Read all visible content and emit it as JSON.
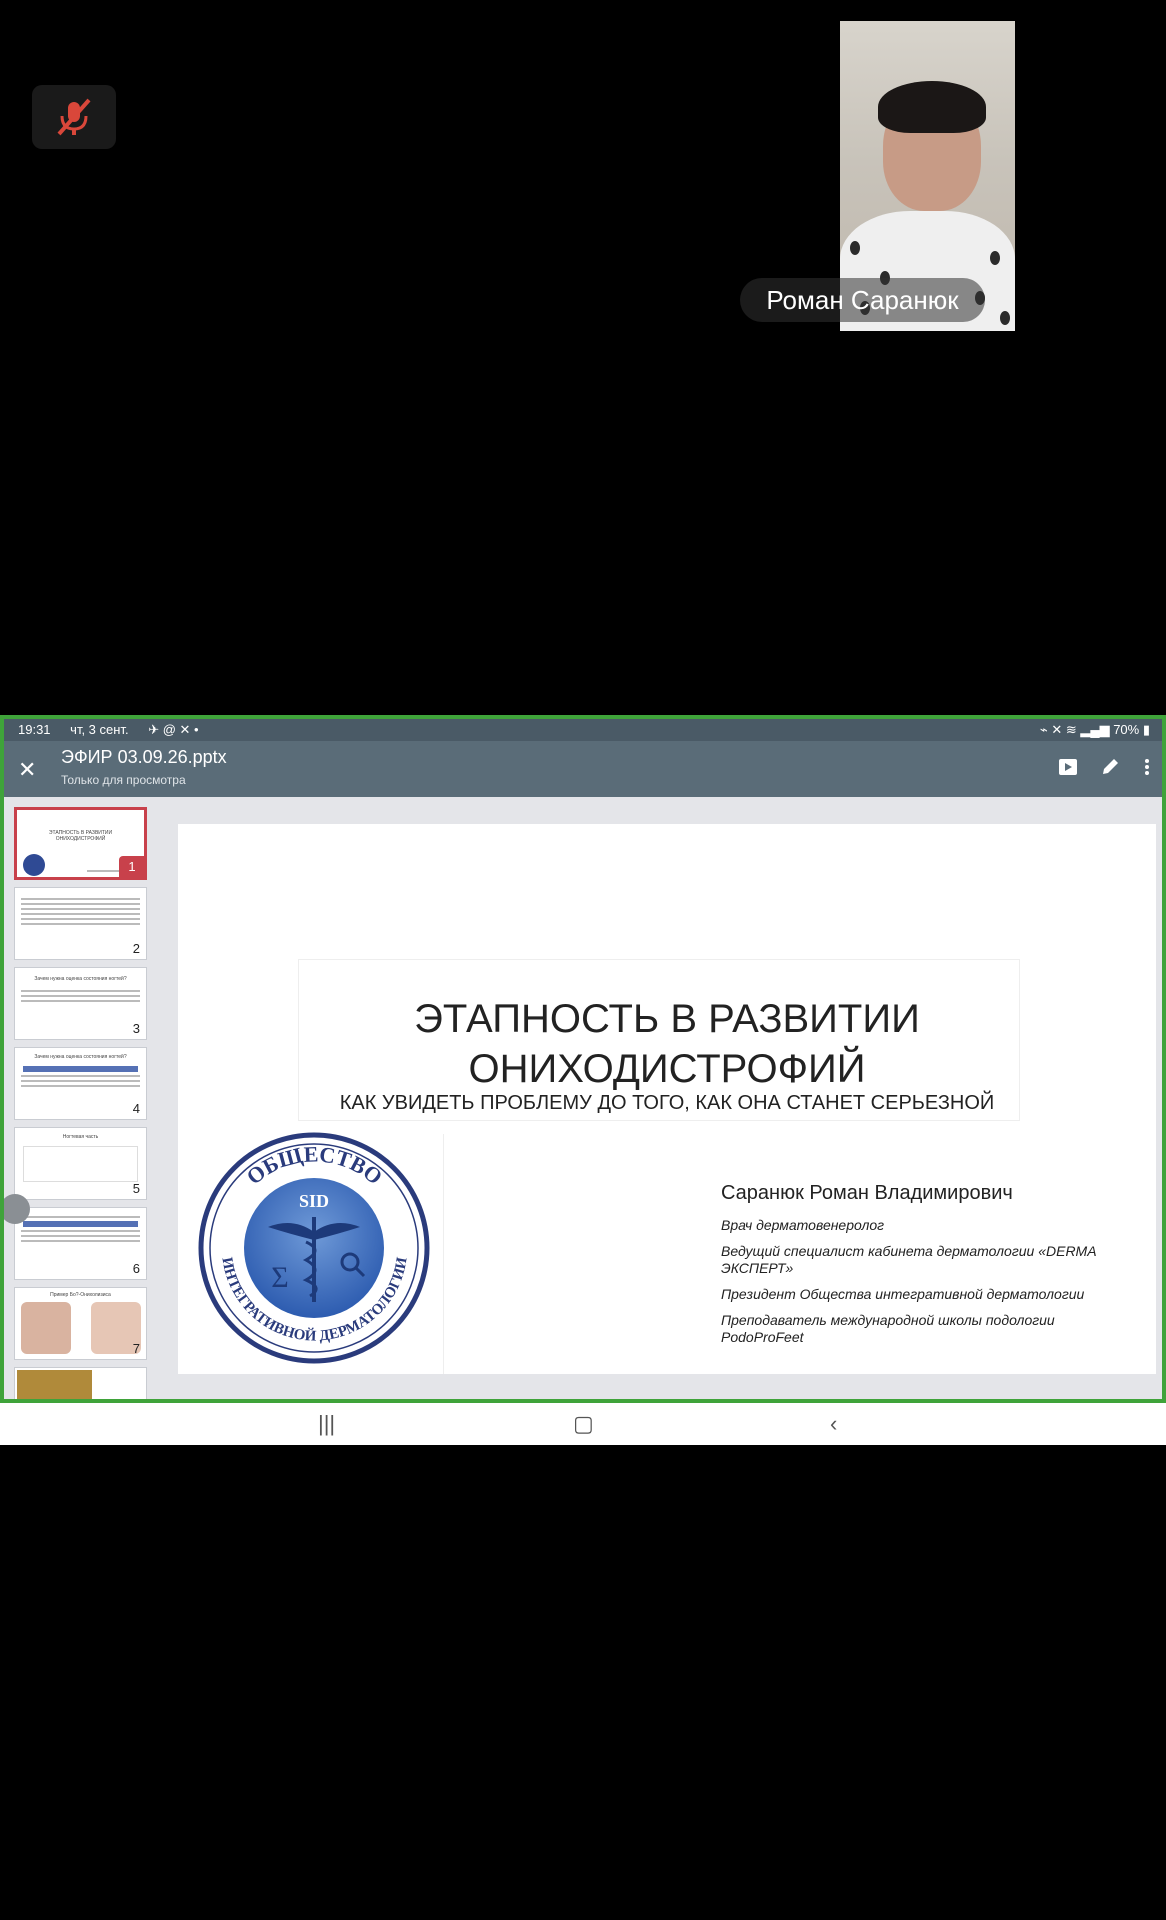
{
  "call": {
    "participant_name": "Роман Саранюк",
    "mute_icon": "mic-off-icon"
  },
  "status": {
    "time": "19:31",
    "date": "чт, 3 сент.",
    "battery": "70%"
  },
  "document": {
    "title": "ЭФИР 03.09.26.pptx",
    "mode": "Только для просмотра",
    "icons": [
      "close-icon",
      "play-icon",
      "edit-icon",
      "more-icon"
    ]
  },
  "thumbnails": [
    {
      "num": "1",
      "text": "ЭТАПНОСТЬ В РАЗВИТИИ ОНИХОДИСТРОФИЙ"
    },
    {
      "num": "2",
      "text": ""
    },
    {
      "num": "3",
      "text": "Зачем нужна оценка состояния ногтей?"
    },
    {
      "num": "4",
      "text": "Зачем нужна оценка состояния ногтей?"
    },
    {
      "num": "5",
      "text": "Ногтевая часть"
    },
    {
      "num": "6",
      "text": ""
    },
    {
      "num": "7",
      "text": "Пример Бо?-Онихолизиса"
    }
  ],
  "slide": {
    "title_line1": "ЭТАПНОСТЬ В РАЗВИТИИ",
    "title_line2": "ОНИХОДИСТРОФИЙ",
    "subtitle": "КАК УВИДЕТЬ ПРОБЛЕМУ ДО ТОГО, КАК ОНА СТАНЕТ СЕРЬЕЗНОЙ",
    "logo": {
      "top_text": "ОБЩЕСТВО",
      "bottom_text": "ИНТЕГРАТИВНОЙ ДЕРМАТОЛОГИИ",
      "abbr": "SID"
    },
    "author_name": "Саранюк Роман Владимирович",
    "author_lines": [
      "Врач дерматовенеролог",
      "Ведущий специалист кабинета дерматологии «DERMA ЭКСПЕРТ»",
      "Президент Общества интегративной дерматологии",
      "Преподаватель международной школы подологии PodoProFeet"
    ]
  },
  "colors": {
    "share_border": "#3fa33a",
    "selected_thumb": "#c8414b",
    "topbar": "#5a6c78"
  }
}
